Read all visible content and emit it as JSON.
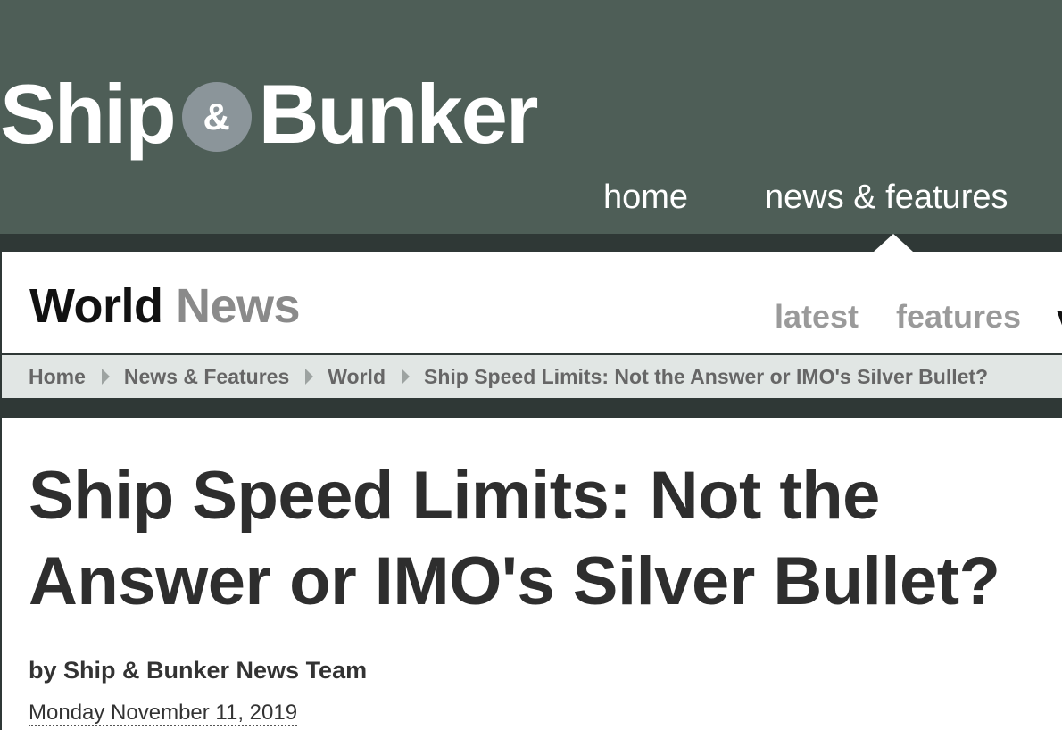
{
  "header": {
    "logo_left": "Ship",
    "logo_amp": "&",
    "logo_right": "Bunker",
    "nav": [
      {
        "label": "home",
        "active": false
      },
      {
        "label": "news & features",
        "active": true
      }
    ]
  },
  "section": {
    "title_main": "World",
    "title_accent": "News",
    "subnav": [
      "latest",
      "features",
      "v"
    ]
  },
  "breadcrumb": [
    "Home",
    "News & Features",
    "World",
    "Ship Speed Limits: Not the Answer or IMO's Silver Bullet?"
  ],
  "article": {
    "title": "Ship Speed Limits: Not the Answer or IMO's Silver Bullet?",
    "byline": "by Ship & Bunker News Team",
    "date": "Monday November 11, 2019"
  },
  "colors": {
    "header_bg": "#4e5e57",
    "page_bg": "#2f3836",
    "logo_amp_circle": "#8b959a",
    "breadcrumb_bg": "#e1e6e4"
  }
}
